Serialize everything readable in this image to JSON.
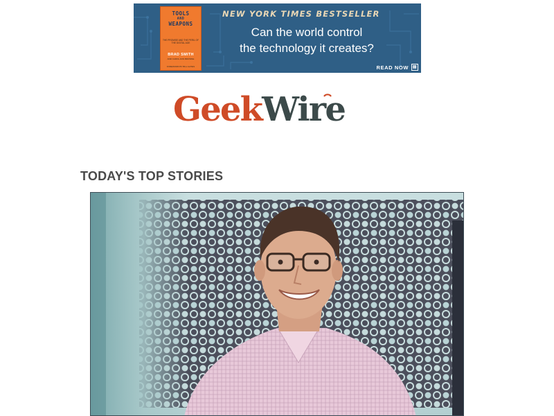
{
  "ad": {
    "book": {
      "title_lines": [
        "TOOLS",
        "AND",
        "WEAPONS"
      ],
      "subtitle": "THE PROMISE AND THE PERIL OF THE DIGITAL AGE",
      "author": "BRAD SMITH",
      "coauthor": "AND CAROL ANN BROWNE",
      "foreword": "FOREWORD BY BILL GATES",
      "cover_color": "#f07a2e"
    },
    "kicker": "NEW YORK TIMES BESTSELLER",
    "headline_line1": "Can the world control",
    "headline_line2": "the technology it creates?",
    "cta": "READ NOW",
    "cta_icon": "book-icon",
    "background_color": "#2f5f86"
  },
  "logo": {
    "part1": "Geek",
    "part2": "Wire",
    "colors": {
      "geek": "#cf4b27",
      "wire": "#3c4a4a"
    }
  },
  "section": {
    "heading": "TODAY'S TOP STORIES"
  },
  "story": {
    "photo_icon": "portrait-photo"
  }
}
